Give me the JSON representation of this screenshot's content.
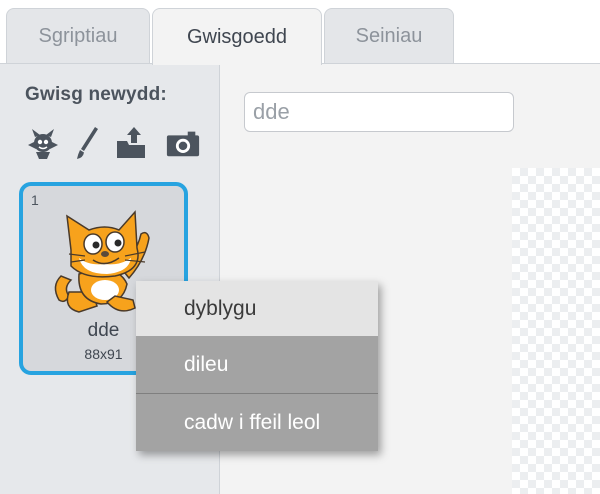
{
  "tabs": [
    {
      "label": "Sgriptiau",
      "active": false
    },
    {
      "label": "Gwisgoedd",
      "active": true
    },
    {
      "label": "Seiniau",
      "active": false
    }
  ],
  "costumes_panel": {
    "new_label": "Gwisg newydd:",
    "new_icons": [
      "sprite-library-icon",
      "paint-brush-icon",
      "upload-icon",
      "camera-icon"
    ],
    "items": [
      {
        "number": "1",
        "name": "dde",
        "size": "88x91",
        "selected": true
      }
    ]
  },
  "editor": {
    "costume_name_value": "dde"
  },
  "context_menu": {
    "items": [
      {
        "label": "dyblygu"
      },
      {
        "label": "dileu"
      },
      {
        "label": "cadw i ffeil leol"
      }
    ]
  },
  "colors": {
    "selection_border": "#27a3e0",
    "menu_highlight": "#a3a3a3",
    "cat_orange": "#f7a21c"
  }
}
